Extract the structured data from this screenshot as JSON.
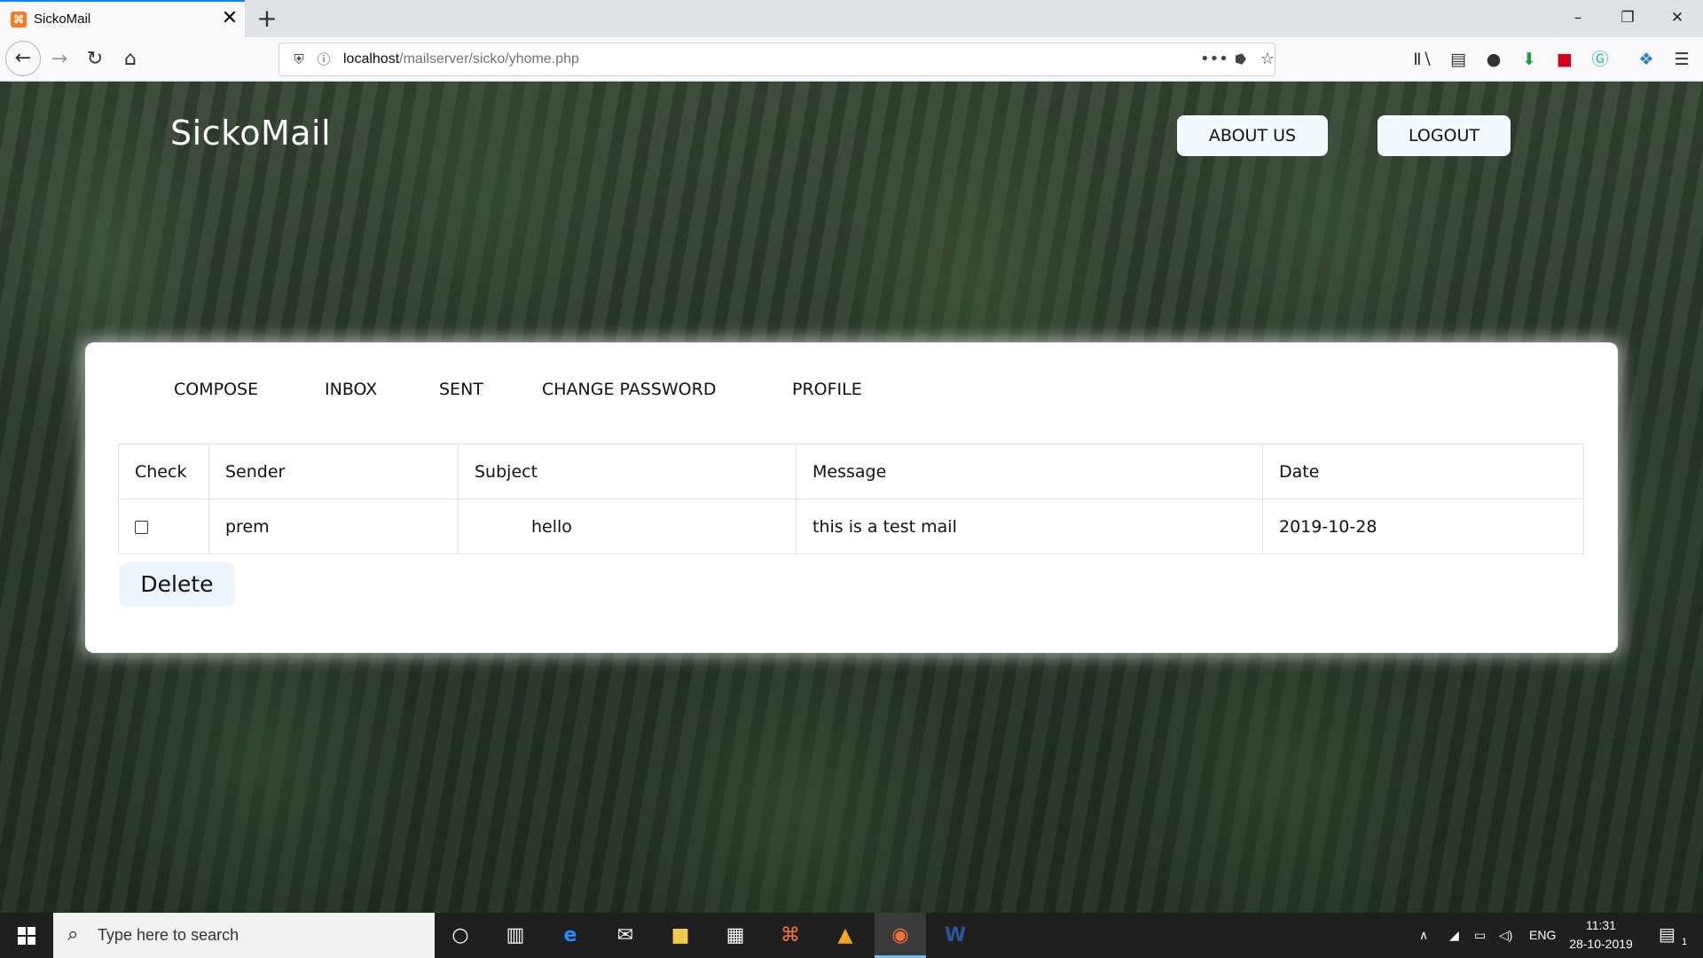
{
  "browser": {
    "tab_title": "SickoMail",
    "tab_favicon": "xampp-icon",
    "url_host": "localhost",
    "url_path": "/mailserver/sicko/yhome.php"
  },
  "site": {
    "brand": "SickoMail",
    "about_label": "ABOUT US",
    "logout_label": "LOGOUT"
  },
  "menu": {
    "items": [
      {
        "label": "COMPOSE"
      },
      {
        "label": "INBOX"
      },
      {
        "label": "SENT"
      },
      {
        "label": "CHANGE PASSWORD"
      },
      {
        "label": "PROFILE"
      }
    ]
  },
  "table": {
    "headers": [
      "Check",
      "Sender",
      "Subject",
      "Message",
      "Date"
    ],
    "rows": [
      {
        "checked": false,
        "sender": "prem",
        "subject": "hello",
        "message": "this is a test mail",
        "date": "2019-10-28"
      }
    ]
  },
  "delete_label": "Delete",
  "taskbar": {
    "search_placeholder": "Type here to search",
    "language": "ENG",
    "time": "11:31",
    "date": "28-10-2019",
    "notification_count": "1"
  },
  "colors": {
    "accent": "#0a84ff",
    "button_bg": "#f2f9ff",
    "card_bg": "#ffffff"
  }
}
